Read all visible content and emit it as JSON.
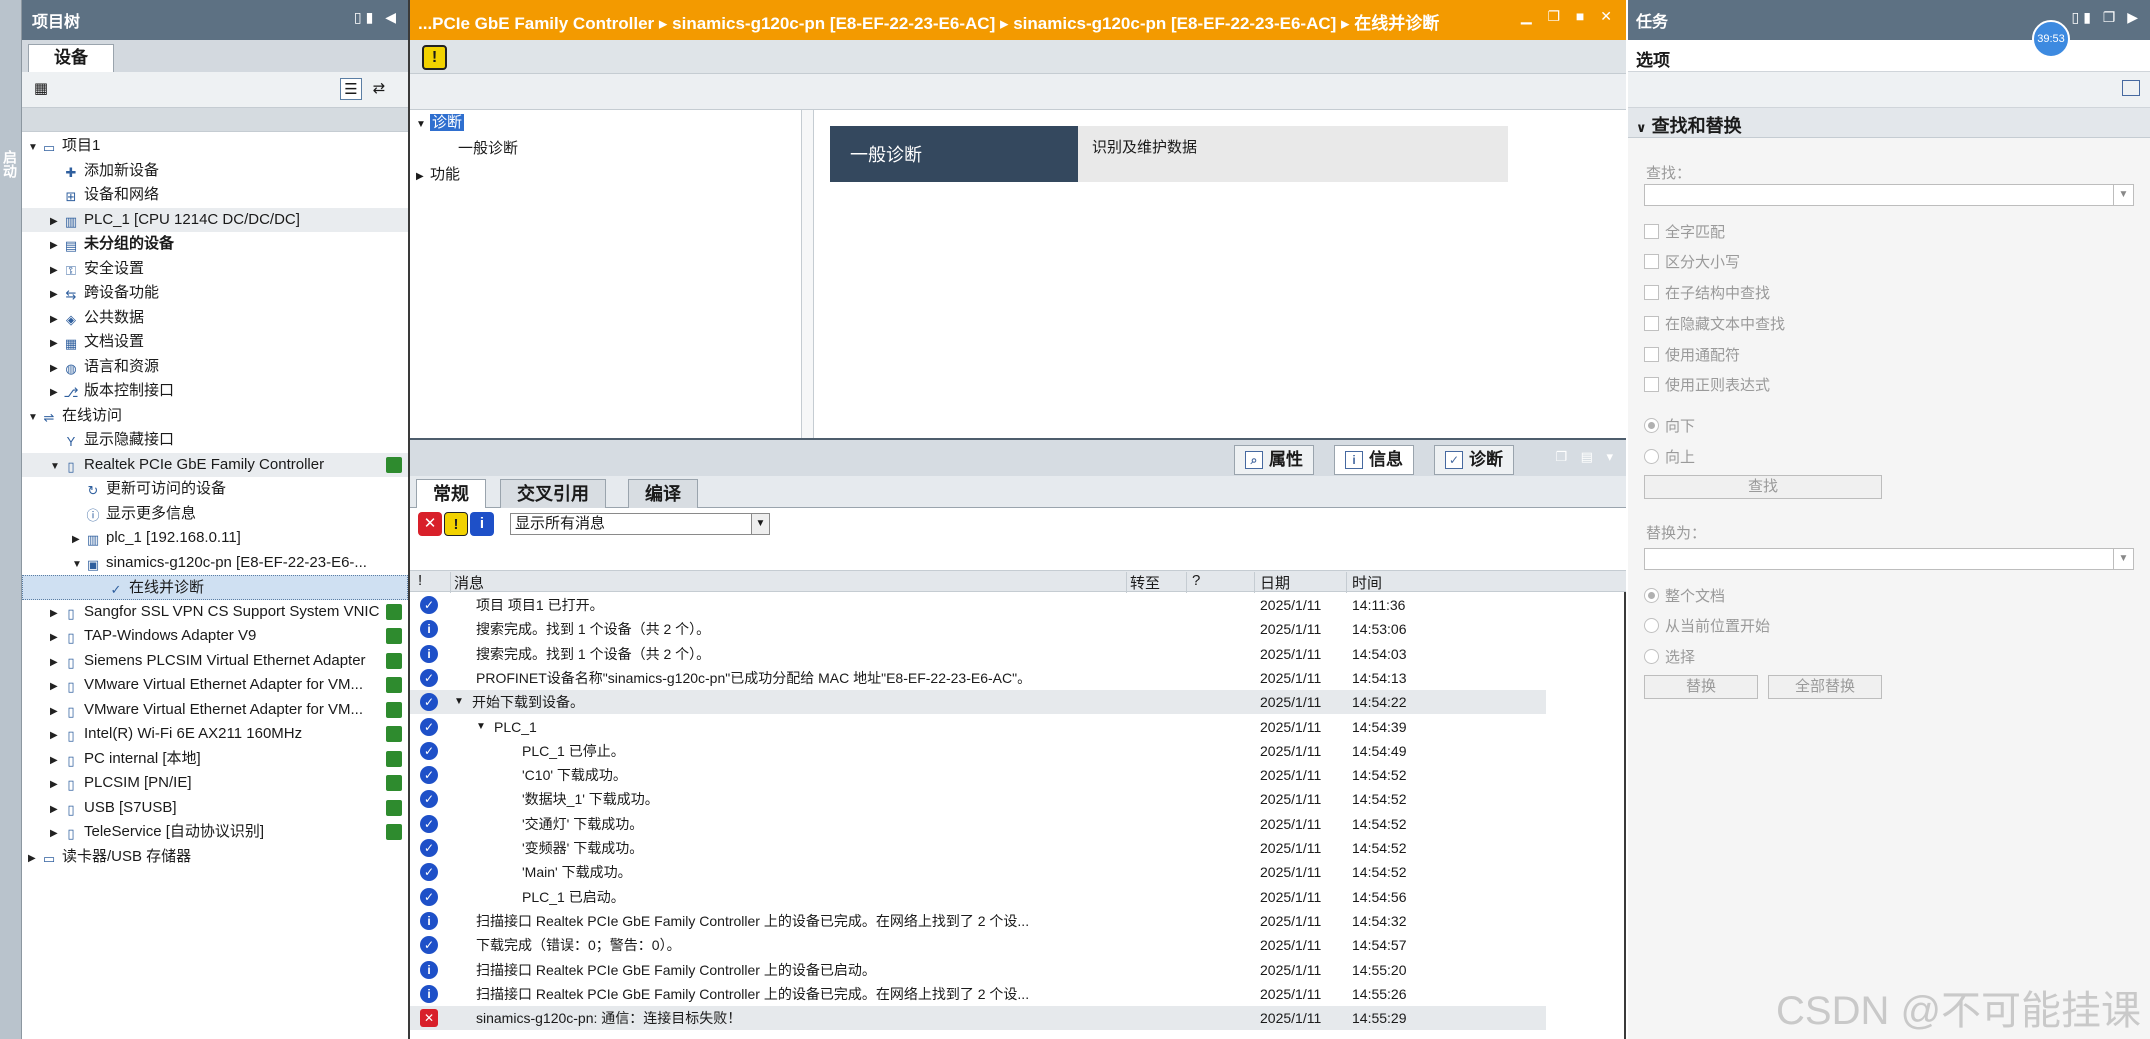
{
  "side_strip": {
    "label": "启动"
  },
  "project_tree": {
    "title": "项目树",
    "tab": "设备",
    "items": [
      {
        "label": "项目1",
        "arrow": "▼",
        "indent": 0,
        "icon": "project-icon"
      },
      {
        "label": "添加新设备",
        "arrow": "",
        "indent": 1,
        "icon": "add-device-icon"
      },
      {
        "label": "设备和网络",
        "arrow": "",
        "indent": 1,
        "icon": "network-icon"
      },
      {
        "label": "PLC_1 [CPU 1214C DC/DC/DC]",
        "arrow": "▶",
        "indent": 1,
        "icon": "plc-icon",
        "shaded": true
      },
      {
        "label": "未分组的设备",
        "arrow": "▶",
        "indent": 1,
        "icon": "folder-icon",
        "bold": true
      },
      {
        "label": "安全设置",
        "arrow": "▶",
        "indent": 1,
        "icon": "security-icon"
      },
      {
        "label": "跨设备功能",
        "arrow": "▶",
        "indent": 1,
        "icon": "cross-device-icon"
      },
      {
        "label": "公共数据",
        "arrow": "▶",
        "indent": 1,
        "icon": "common-data-icon"
      },
      {
        "label": "文档设置",
        "arrow": "▶",
        "indent": 1,
        "icon": "document-icon"
      },
      {
        "label": "语言和资源",
        "arrow": "▶",
        "indent": 1,
        "icon": "language-icon"
      },
      {
        "label": "版本控制接口",
        "arrow": "▶",
        "indent": 1,
        "icon": "version-icon"
      },
      {
        "label": "在线访问",
        "arrow": "▼",
        "indent": 0,
        "icon": "online-access-icon"
      },
      {
        "label": "显示隐藏接口",
        "arrow": "",
        "indent": 1,
        "icon": "interface-icon"
      },
      {
        "label": "Realtek PCIe GbE Family Controller",
        "arrow": "▼",
        "indent": 1,
        "icon": "adapter-icon",
        "status": true,
        "shaded": true
      },
      {
        "label": "更新可访问的设备",
        "arrow": "",
        "indent": 2,
        "icon": "refresh-devices-icon"
      },
      {
        "label": "显示更多信息",
        "arrow": "",
        "indent": 2,
        "icon": "info-icon"
      },
      {
        "label": "plc_1 [192.168.0.11]",
        "arrow": "▶",
        "indent": 2,
        "icon": "plc-icon"
      },
      {
        "label": "sinamics-g120c-pn [E8-EF-22-23-E6-...",
        "arrow": "▼",
        "indent": 2,
        "icon": "drive-icon"
      },
      {
        "label": "在线并诊断",
        "arrow": "",
        "indent": 3,
        "icon": "diagnostics-icon",
        "selected": true
      },
      {
        "label": "Sangfor SSL VPN CS Support System VNIC",
        "arrow": "▶",
        "indent": 1,
        "icon": "adapter-icon",
        "status": true
      },
      {
        "label": "TAP-Windows Adapter V9",
        "arrow": "▶",
        "indent": 1,
        "icon": "adapter-icon",
        "status": true
      },
      {
        "label": "Siemens PLCSIM Virtual Ethernet Adapter",
        "arrow": "▶",
        "indent": 1,
        "icon": "adapter-icon",
        "status": true
      },
      {
        "label": "VMware Virtual Ethernet Adapter for VM...",
        "arrow": "▶",
        "indent": 1,
        "icon": "adapter-icon",
        "status": true
      },
      {
        "label": "VMware Virtual Ethernet Adapter for VM...",
        "arrow": "▶",
        "indent": 1,
        "icon": "adapter-icon",
        "status": true
      },
      {
        "label": "Intel(R) Wi-Fi 6E AX211 160MHz",
        "arrow": "▶",
        "indent": 1,
        "icon": "wifi-adapter-icon",
        "status": true
      },
      {
        "label": "PC internal [本地]",
        "arrow": "▶",
        "indent": 1,
        "icon": "adapter-icon",
        "status": true
      },
      {
        "label": "PLCSIM [PN/IE]",
        "arrow": "▶",
        "indent": 1,
        "icon": "adapter-icon",
        "status": true
      },
      {
        "label": "USB [S7USB]",
        "arrow": "▶",
        "indent": 1,
        "icon": "usb-icon",
        "status": true
      },
      {
        "label": "TeleService [自动协议识别]",
        "arrow": "▶",
        "indent": 1,
        "icon": "teleservice-icon",
        "status": true
      },
      {
        "label": "读卡器/USB 存储器",
        "arrow": "▶",
        "indent": 0,
        "icon": "card-reader-icon"
      }
    ]
  },
  "editor": {
    "breadcrumb": "...PCIe GbE Family Controller  ▸  sinamics-g120c-pn [E8-EF-22-23-E6-AC]  ▸  sinamics-g120c-pn [E8-EF-22-23-E6-AC]  ▸  在线并诊断",
    "nav": {
      "diagnostics": "诊断",
      "general_diagnostics": "一般诊断",
      "functions": "功能"
    },
    "section_title": "一般诊断",
    "section_subtitle": "识别及维护数据"
  },
  "inspector": {
    "tabs": [
      "属性",
      "信息",
      "诊断"
    ],
    "subtabs": [
      "常规",
      "交叉引用",
      "编译"
    ],
    "filter_value": "显示所有消息",
    "columns": {
      "bang": "!",
      "message": "消息",
      "goto": "转至",
      "question": "?",
      "date": "日期",
      "time": "时间"
    },
    "messages": [
      {
        "type": "ok",
        "arrow": "",
        "indent": 0,
        "text": "项目 项目1 已打开。",
        "date": "2025/1/11",
        "time": "14:11:36"
      },
      {
        "type": "info",
        "arrow": "",
        "indent": 0,
        "text": "搜索完成。找到 1 个设备（共 2 个）。",
        "date": "2025/1/11",
        "time": "14:53:06"
      },
      {
        "type": "info",
        "arrow": "",
        "indent": 0,
        "text": "搜索完成。找到 1 个设备（共 2 个）。",
        "date": "2025/1/11",
        "time": "14:54:03"
      },
      {
        "type": "ok",
        "arrow": "",
        "indent": 0,
        "text": "PROFINET设备名称\"sinamics-g120c-pn\"已成功分配给 MAC 地址\"E8-EF-22-23-E6-AC\"。",
        "date": "2025/1/11",
        "time": "14:54:13"
      },
      {
        "type": "ok",
        "arrow": "▼",
        "indent": 0,
        "text": "开始下载到设备。",
        "date": "2025/1/11",
        "time": "14:54:22",
        "shade": true
      },
      {
        "type": "ok",
        "arrow": "▼",
        "indent": 1,
        "text": "PLC_1",
        "date": "2025/1/11",
        "time": "14:54:39"
      },
      {
        "type": "ok",
        "arrow": "",
        "indent": 2,
        "text": "PLC_1 已停止。",
        "date": "2025/1/11",
        "time": "14:54:49"
      },
      {
        "type": "ok",
        "arrow": "",
        "indent": 2,
        "text": "'C10' 下载成功。",
        "date": "2025/1/11",
        "time": "14:54:52"
      },
      {
        "type": "ok",
        "arrow": "",
        "indent": 2,
        "text": "'数据块_1' 下载成功。",
        "date": "2025/1/11",
        "time": "14:54:52"
      },
      {
        "type": "ok",
        "arrow": "",
        "indent": 2,
        "text": "'交通灯' 下载成功。",
        "date": "2025/1/11",
        "time": "14:54:52"
      },
      {
        "type": "ok",
        "arrow": "",
        "indent": 2,
        "text": "'变频器' 下载成功。",
        "date": "2025/1/11",
        "time": "14:54:52"
      },
      {
        "type": "ok",
        "arrow": "",
        "indent": 2,
        "text": "'Main' 下载成功。",
        "date": "2025/1/11",
        "time": "14:54:52"
      },
      {
        "type": "ok",
        "arrow": "",
        "indent": 2,
        "text": "PLC_1 已启动。",
        "date": "2025/1/11",
        "time": "14:54:56"
      },
      {
        "type": "info",
        "arrow": "",
        "indent": 0,
        "text": "扫描接口 Realtek PCIe GbE Family Controller 上的设备已完成。在网络上找到了 2 个设...",
        "date": "2025/1/11",
        "time": "14:54:32"
      },
      {
        "type": "ok",
        "arrow": "",
        "indent": 0,
        "text": "下载完成（错误：0；警告：0）。",
        "date": "2025/1/11",
        "time": "14:54:57"
      },
      {
        "type": "info",
        "arrow": "",
        "indent": 0,
        "text": "扫描接口 Realtek PCIe GbE Family Controller 上的设备已启动。",
        "date": "2025/1/11",
        "time": "14:55:20"
      },
      {
        "type": "info",
        "arrow": "",
        "indent": 0,
        "text": "扫描接口 Realtek PCIe GbE Family Controller 上的设备已完成。在网络上找到了 2 个设...",
        "date": "2025/1/11",
        "time": "14:55:26"
      },
      {
        "type": "error",
        "arrow": "",
        "indent": 0,
        "text": "sinamics-g120c-pn: 通信：连接目标失败！",
        "date": "2025/1/11",
        "time": "14:55:29",
        "shade": true
      }
    ]
  },
  "task_panel": {
    "title": "任务",
    "timer": "39:53",
    "options": "选项",
    "find_replace": "查找和替换",
    "find_label": "查找：",
    "checks": [
      "全字匹配",
      "区分大小写",
      "在子结构中查找",
      "在隐藏文本中查找",
      "使用通配符",
      "使用正则表达式"
    ],
    "direction": [
      "向下",
      "向上"
    ],
    "find_button": "查找",
    "replace_label": "替换为：",
    "scope": [
      "整个文档",
      "从当前位置开始",
      "选择"
    ],
    "replace_button": "替换",
    "replace_all_button": "全部替换"
  },
  "watermark": "CSDN @不可能挂课",
  "colors": {
    "title_orange": "#f39a00",
    "panel_head": "#5d7183",
    "section_dark": "#34485e",
    "ok_blue": "#1e50c8",
    "error_red": "#d8202a"
  }
}
